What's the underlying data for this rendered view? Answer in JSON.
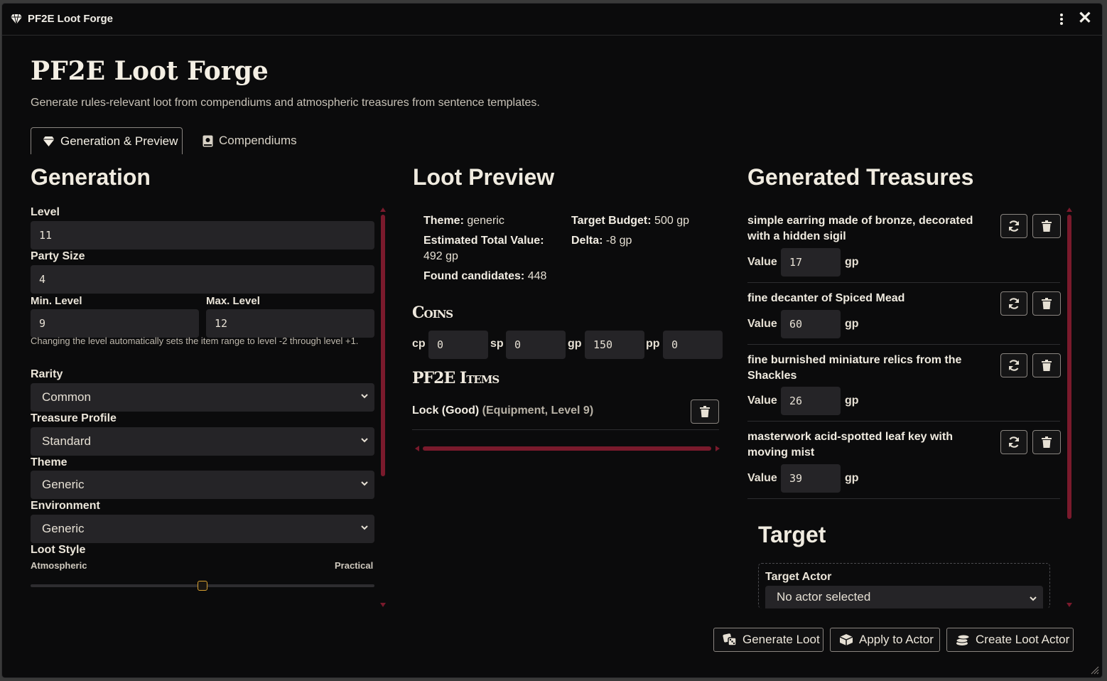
{
  "window": {
    "title": "PF2E Loot Forge"
  },
  "header": {
    "title": "PF2E Loot Forge",
    "subtitle": "Generate rules-relevant loot from compendiums and atmospheric treasures from sentence templates."
  },
  "tabs": [
    {
      "label": "Generation & Preview",
      "active": true,
      "icon": "gem-icon"
    },
    {
      "label": "Compendiums",
      "active": false,
      "icon": "book-icon"
    }
  ],
  "generation": {
    "heading": "Generation",
    "level": {
      "label": "Level",
      "value": "11"
    },
    "party_size": {
      "label": "Party Size",
      "value": "4"
    },
    "min_level": {
      "label": "Min. Level",
      "value": "9"
    },
    "max_level": {
      "label": "Max. Level",
      "value": "12"
    },
    "level_hint": "Changing the level automatically sets the item range to level -2 through level +1.",
    "rarity": {
      "label": "Rarity",
      "value": "Common"
    },
    "treasure_profile": {
      "label": "Treasure Profile",
      "value": "Standard"
    },
    "theme": {
      "label": "Theme",
      "value": "Generic"
    },
    "environment": {
      "label": "Environment",
      "value": "Generic"
    },
    "loot_style": {
      "label": "Loot Style",
      "left": "Atmospheric",
      "right": "Practical",
      "position": 0.5
    }
  },
  "preview": {
    "heading": "Loot Preview",
    "theme_label": "Theme:",
    "theme_value": "generic",
    "budget_label": "Target Budget:",
    "budget_value": "500 gp",
    "estimated_label": "Estimated Total Value:",
    "estimated_value": "492 gp",
    "delta_label": "Delta:",
    "delta_value": "-8 gp",
    "found_label": "Found candidates:",
    "found_value": "448",
    "coins_heading": "Coins",
    "coins": [
      {
        "label": "cp",
        "value": "0"
      },
      {
        "label": "sp",
        "value": "0"
      },
      {
        "label": "gp",
        "value": "150"
      },
      {
        "label": "pp",
        "value": "0"
      }
    ],
    "items_heading": "PF2E Items",
    "items": [
      {
        "name": "Lock (Good)",
        "meta": "(Equipment, Level 9)"
      }
    ]
  },
  "treasures": {
    "heading": "Generated Treasures",
    "value_label": "Value",
    "unit": "gp",
    "items": [
      {
        "name": "simple earring made of bronze, decorated with a hidden sigil",
        "value": "17"
      },
      {
        "name": "fine decanter of Spiced Mead",
        "value": "60"
      },
      {
        "name": "fine burnished miniature relics from the Shackles",
        "value": "26"
      },
      {
        "name": "masterwork acid-spotted leaf key with moving mist",
        "value": "39"
      }
    ]
  },
  "target": {
    "heading": "Target",
    "actor_label": "Target Actor",
    "actor_value": "No actor selected"
  },
  "actions": {
    "generate": "Generate Loot",
    "apply": "Apply to Actor",
    "create": "Create Loot Actor"
  },
  "colors": {
    "accent": "#7a1a2c",
    "field_bg": "#252427",
    "window_bg": "#0b0b0c",
    "slider_thumb": "#d8a030"
  }
}
